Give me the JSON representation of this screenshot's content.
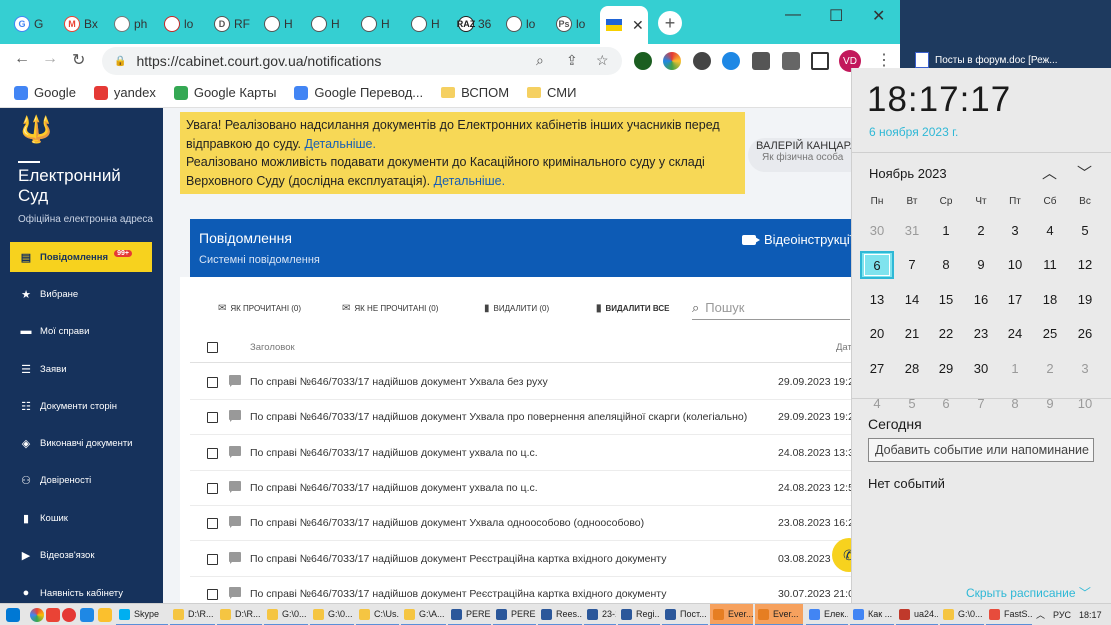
{
  "browser": {
    "tabs": [
      {
        "title": "G",
        "icon_color": "#4285f4",
        "fav": "G"
      },
      {
        "title": "Вх",
        "icon_color": "#ea4335",
        "fav": "M"
      },
      {
        "title": "ph",
        "icon_color": "#777777",
        "fav": ""
      },
      {
        "title": "lo",
        "icon_color": "#c62828",
        "fav": ""
      },
      {
        "title": "RF",
        "icon_color": "#555555",
        "fav": "D"
      },
      {
        "title": "Н",
        "icon_color": "#555555",
        "fav": ""
      },
      {
        "title": "Н",
        "icon_color": "#555555",
        "fav": ""
      },
      {
        "title": "Н",
        "icon_color": "#555555",
        "fav": ""
      },
      {
        "title": "Н",
        "icon_color": "#555555",
        "fav": ""
      },
      {
        "title": "36",
        "icon_color": "#222222",
        "fav": "RAZ"
      },
      {
        "title": "lo",
        "icon_color": "#555555",
        "fav": ""
      },
      {
        "title": "lo",
        "icon_color": "#555555",
        "fav": "Ps"
      }
    ],
    "active_tab_close": "✕",
    "new_tab": "+",
    "window_controls": {
      "minimize": "—",
      "maximize": "☐",
      "close": "✕"
    },
    "url": "https://cabinet.court.gov.ua/notifications",
    "avatar": "VD",
    "bookmarks": [
      {
        "label": "Google",
        "color": "#4285f4",
        "type": "site"
      },
      {
        "label": "yandex",
        "color": "#e53935",
        "type": "site"
      },
      {
        "label": "Google Карты",
        "color": "#34a853",
        "type": "site"
      },
      {
        "label": "Google Перевод...",
        "color": "#4285f4",
        "type": "site"
      },
      {
        "label": "ВСПОМ",
        "color": "#f5d061",
        "type": "folder"
      },
      {
        "label": "СМИ",
        "color": "#f5d061",
        "type": "folder"
      }
    ]
  },
  "sidebar": {
    "brand": "Електронний\nСуд",
    "brand_sub": "Офіційна електронна адреса",
    "items": [
      {
        "label": "Повідомлення",
        "icon": "message-icon",
        "glyph": "▤",
        "badge": "99+",
        "active": true
      },
      {
        "label": "Вибране",
        "icon": "star-icon",
        "glyph": "★"
      },
      {
        "label": "Мої справи",
        "icon": "folder-icon",
        "glyph": "▬"
      },
      {
        "label": "Заяви",
        "icon": "list-icon",
        "glyph": "☰"
      },
      {
        "label": "Документи сторін",
        "icon": "checklist-icon",
        "glyph": "☷"
      },
      {
        "label": "Виконавчі документи",
        "icon": "layers-icon",
        "glyph": "◈"
      },
      {
        "label": "Довіреності",
        "icon": "people-icon",
        "glyph": "⚇"
      },
      {
        "label": "Кошик",
        "icon": "trash-icon",
        "glyph": "▮"
      },
      {
        "label": "Відеозв'язок",
        "icon": "video-icon",
        "glyph": "▶"
      },
      {
        "label": "Наявність кабінету",
        "icon": "person-icon",
        "glyph": "●"
      }
    ]
  },
  "notice": {
    "line1": "Увага! Реалізовано надсилання документів до Електронних кабінетів інших учасників перед відправкою до суду. ",
    "link1": "Детальніше.",
    "line2": "Реалізовано можливість подавати документи до Касаційного кримінального суду у складі Верховного Суду (дослідна експлуатація). ",
    "link2": "Детальніше."
  },
  "user": {
    "name": "ВАЛЕРІЙ КАНЦАРА",
    "role": "Як фізична особа"
  },
  "panel": {
    "title": "Повідомлення",
    "subtitle": "Системні повідомлення",
    "video_instructions": "Відеоінструкції"
  },
  "actions": {
    "mark_read": "ЯК ПРОЧИТАНІ (0)",
    "mark_unread": "ЯК НЕ ПРОЧИТАНІ (0)",
    "delete": "ВИДАЛИТИ (0)",
    "delete_all": "ВИДАЛИТИ ВСЕ",
    "search_placeholder": "Пошук"
  },
  "table": {
    "col_subject": "Заголовок",
    "col_date": "Дата",
    "rows": [
      {
        "text": "По справі №646/7033/17 надійшов документ Ухвала без руху",
        "date": "29.09.2023 19:2"
      },
      {
        "text": "По справі №646/7033/17 надійшов документ Ухвала про повернення апеляційної скарги (колегіально)",
        "date": "29.09.2023 19:2"
      },
      {
        "text": "По справі №646/7033/17 надійшов документ ухвала по ц.с.",
        "date": "24.08.2023 13:3"
      },
      {
        "text": "По справі №646/7033/17 надійшов документ ухвала по ц.с.",
        "date": "24.08.2023 12:5"
      },
      {
        "text": "По справі №646/7033/17 надійшов документ Ухвала одноособово (одноособово)",
        "date": "23.08.2023 16:2"
      },
      {
        "text": "По справі №646/7033/17 надійшов документ Реєстраційна картка вхідного документу",
        "date": "03.08.2023"
      },
      {
        "text": "По справі №646/7033/17 надійшов документ Реєстраційна картка вхідного документу",
        "date": "30.07.2023 21:0"
      }
    ]
  },
  "desktop": {
    "file": "Посты в форум.doc [Реж..."
  },
  "calendar": {
    "time": "18:17:17",
    "date": "6 ноября 2023 г.",
    "month": "Ноябрь 2023",
    "weekdays": [
      "Пн",
      "Вт",
      "Ср",
      "Чт",
      "Пт",
      "Сб",
      "Вс"
    ],
    "weeks": [
      [
        {
          "d": "30",
          "dim": true
        },
        {
          "d": "31",
          "dim": true
        },
        {
          "d": "1"
        },
        {
          "d": "2"
        },
        {
          "d": "3"
        },
        {
          "d": "4"
        },
        {
          "d": "5"
        }
      ],
      [
        {
          "d": "6",
          "today": true
        },
        {
          "d": "7"
        },
        {
          "d": "8"
        },
        {
          "d": "9"
        },
        {
          "d": "10"
        },
        {
          "d": "11"
        },
        {
          "d": "12"
        }
      ],
      [
        {
          "d": "13"
        },
        {
          "d": "14"
        },
        {
          "d": "15"
        },
        {
          "d": "16"
        },
        {
          "d": "17"
        },
        {
          "d": "18"
        },
        {
          "d": "19"
        }
      ],
      [
        {
          "d": "20"
        },
        {
          "d": "21"
        },
        {
          "d": "22"
        },
        {
          "d": "23"
        },
        {
          "d": "24"
        },
        {
          "d": "25"
        },
        {
          "d": "26"
        }
      ],
      [
        {
          "d": "27"
        },
        {
          "d": "28"
        },
        {
          "d": "29"
        },
        {
          "d": "30"
        },
        {
          "d": "1",
          "dim": true
        },
        {
          "d": "2",
          "dim": true
        },
        {
          "d": "3",
          "dim": true
        }
      ],
      [
        {
          "d": "4",
          "dim": true
        },
        {
          "d": "5",
          "dim": true
        },
        {
          "d": "6",
          "dim": true
        },
        {
          "d": "7",
          "dim": true
        },
        {
          "d": "8",
          "dim": true
        },
        {
          "d": "9",
          "dim": true
        },
        {
          "d": "10",
          "dim": true
        }
      ]
    ],
    "today_label": "Сегодня",
    "add_event": "Добавить событие или напоминание",
    "no_events": "Нет событий",
    "hide_schedule": "Скрыть расписание"
  },
  "taskbar": {
    "items": [
      {
        "label": "Skype",
        "color": "#00aff0"
      },
      {
        "label": "D:\\R...",
        "color": "#f5c542"
      },
      {
        "label": "D:\\R...",
        "color": "#f5c542"
      },
      {
        "label": "G:\\0...",
        "color": "#f5c542"
      },
      {
        "label": "G:\\0...",
        "color": "#f5c542"
      },
      {
        "label": "C:\\Us...",
        "color": "#f5c542"
      },
      {
        "label": "G:\\A...",
        "color": "#f5c542"
      },
      {
        "label": "PERE...",
        "color": "#2b579a"
      },
      {
        "label": "PERE...",
        "color": "#2b579a"
      },
      {
        "label": "Rees...",
        "color": "#2b579a"
      },
      {
        "label": "23-1...",
        "color": "#2b579a"
      },
      {
        "label": "Regi...",
        "color": "#2b579a"
      },
      {
        "label": "Пост...",
        "color": "#2b579a"
      },
      {
        "label": "Ever...",
        "color": "#e67e22",
        "orange": true
      },
      {
        "label": "Ever...",
        "color": "#e67e22",
        "orange": true
      },
      {
        "label": "Елек...",
        "color": "#4285f4"
      },
      {
        "label": "Как ...",
        "color": "#4285f4"
      },
      {
        "label": "ua24...",
        "color": "#c0392b"
      },
      {
        "label": "G:\\0...",
        "color": "#f5c542"
      },
      {
        "label": "FastS...",
        "color": "#e74c3c"
      }
    ],
    "language": "РУС",
    "time": "18:17"
  }
}
